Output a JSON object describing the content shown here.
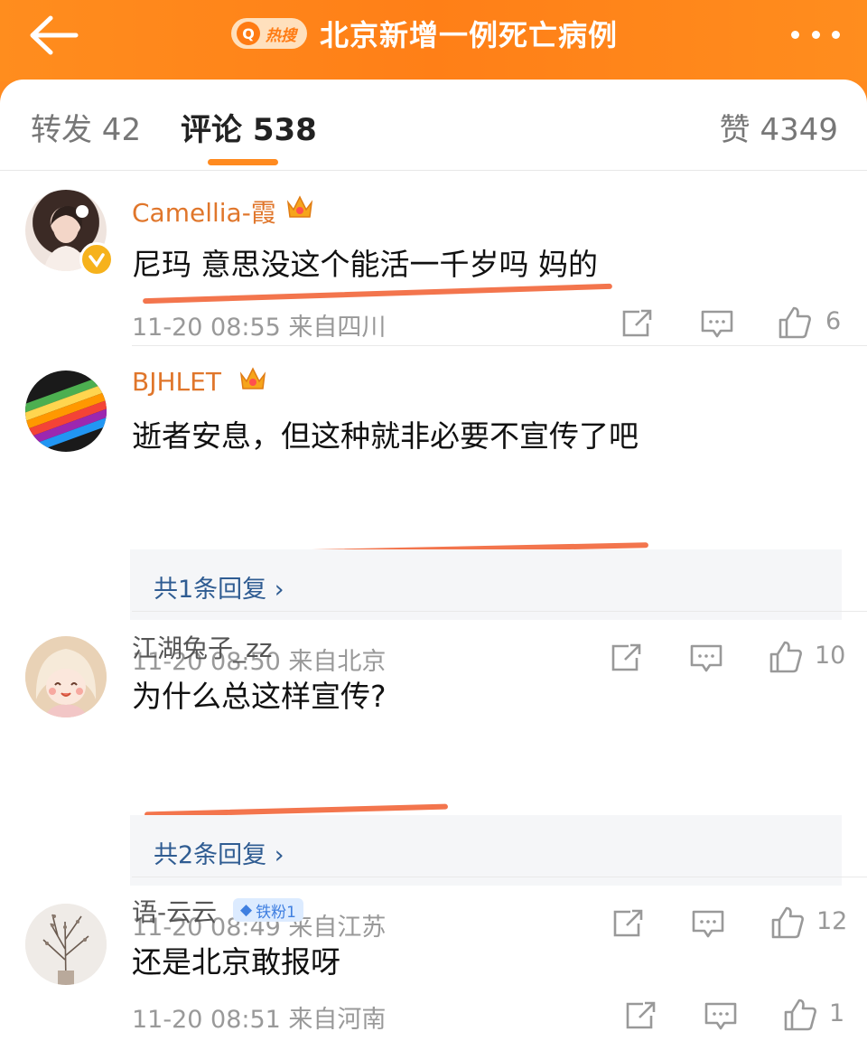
{
  "header": {
    "hot_badge_label": "热搜",
    "topic_title": "北京新增一例死亡病例"
  },
  "tabs": {
    "repost": "转发 42",
    "comment": "评论 538",
    "like": "赞 4349"
  },
  "comments": [
    {
      "username": "Camellia-霞",
      "text": "尼玛 意思没这个能活一千岁吗 妈的",
      "meta": "11-20 08:55  来自四川",
      "likes": "6",
      "username_color": "#e0762b"
    },
    {
      "username": "BJHLET",
      "text": "逝者安息，但这种就非必要不宣传了吧",
      "replies": "共1条回复 ›",
      "meta": "11-20 08:50  来自北京",
      "likes": "10",
      "username_color": "#e0762b"
    },
    {
      "username": "江湖兔子_zz",
      "text": "为什么总这样宣传?",
      "replies": "共2条回复 ›",
      "meta": "11-20 08:49  来自江苏",
      "likes": "12",
      "username_color": "#555555"
    },
    {
      "username": "语-云云",
      "fan_badge": "铁粉1",
      "text": "还是北京敢报呀",
      "meta": "11-20 08:51  来自河南",
      "likes": "1",
      "username_color": "#555555"
    }
  ],
  "colors": {
    "accent": "#ff8a1f",
    "highlight_underline": "#f2663a",
    "reply_link": "#2f5c92"
  }
}
